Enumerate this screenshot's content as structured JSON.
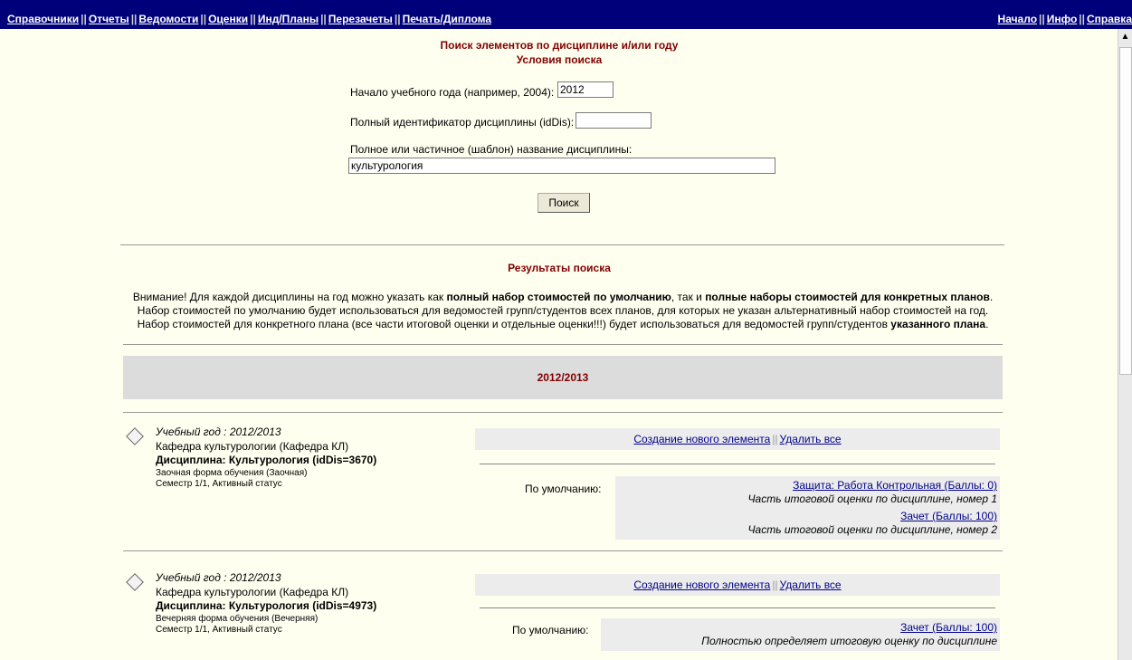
{
  "nav": {
    "left_items": [
      {
        "label": "Справочники"
      },
      {
        "label": "Отчеты"
      },
      {
        "label": "Ведомости"
      },
      {
        "label": "Оценки"
      },
      {
        "label": "Инд/Планы"
      },
      {
        "label": "Перезачеты"
      },
      {
        "label": "Печать/Диплома"
      }
    ],
    "right_items": [
      {
        "label": "Начало"
      },
      {
        "label": "Инфо"
      },
      {
        "label": "Справка"
      }
    ],
    "separator": "||"
  },
  "search": {
    "title": "Поиск элементов по дисциплине и/или году",
    "subtitle": "Условия поиска",
    "year_label": "Начало учебного года (например, 2004):",
    "year_value": "2012",
    "iddis_label": "Полный идентификатор дисциплины (idDis):",
    "iddis_value": "",
    "name_label": "Полное или частичное (шаблон) название дисциплины:",
    "name_value": "культурология",
    "button_label": "Поиск"
  },
  "results": {
    "title": "Результаты поиска",
    "notice": {
      "p1_a": "Внимание! Для каждой дисциплины на год можно указать как ",
      "p1_b": "полный набор стоимостей по умолчанию",
      "p1_c": ", так и ",
      "p1_d": "полные наборы стоимостей для конкретных планов",
      "p1_e": ".",
      "p2": "Набор стоимостей по умолчанию будет использоваться для ведомостей групп/студентов всех планов, для которых не указан альтернативный набор стоимостей на год.",
      "p3_a": "Набор стоимостей для конкретного плана (все части итоговой оценки и отдельные оценки!!!) будет использоваться для ведомостей групп/студентов ",
      "p3_b": "указанного плана",
      "p3_c": "."
    },
    "year_header": "2012/2013",
    "entries": [
      {
        "year": "Учебный год : 2012/2013",
        "department": "Кафедра культурологии (Кафедра КЛ)",
        "discipline": "Дисциплина: Культурология (idDis=3670)",
        "form": "Заочная форма обучения (Заочная)",
        "semester": "Семестр 1/1, Активный статус",
        "create_link": "Создание нового элемента",
        "delete_link": "Удалить все",
        "default_label": "По умолчанию:",
        "items": [
          {
            "link": "Защита: Работа Контрольная (Баллы: 0)",
            "desc": "Часть итоговой оценки по дисциплине, номер 1"
          },
          {
            "link": "Зачет (Баллы: 100)",
            "desc": "Часть итоговой оценки по дисциплине, номер 2"
          }
        ]
      },
      {
        "year": "Учебный год : 2012/2013",
        "department": "Кафедра культурологии (Кафедра КЛ)",
        "discipline": "Дисциплина: Культурология (idDis=4973)",
        "form": "Вечерняя форма обучения (Вечерняя)",
        "semester": "Семестр 1/1, Активный статус",
        "create_link": "Создание нового элемента",
        "delete_link": "Удалить все",
        "default_label": "По умолчанию:",
        "items": [
          {
            "link": "Зачет (Баллы: 100)",
            "desc": "Полностью определяет итоговую оценку по дисциплине"
          }
        ]
      }
    ]
  },
  "colors": {
    "nav_bg": "#00007a",
    "page_bg": "#fffff0",
    "heading": "#800000",
    "link": "#00008b",
    "panel_bg": "#ececec"
  }
}
